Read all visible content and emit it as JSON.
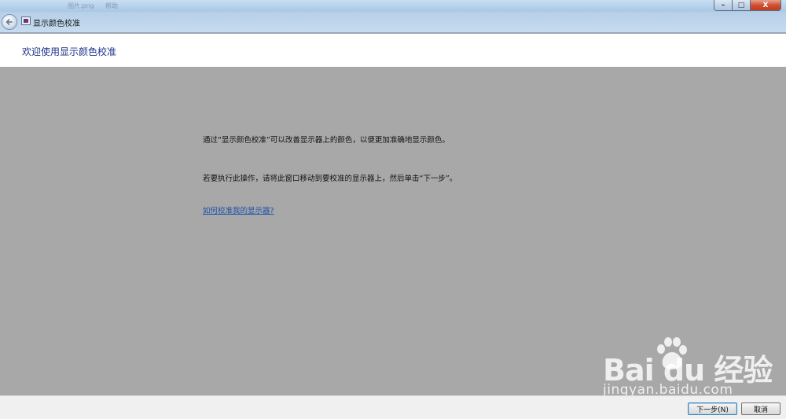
{
  "titlebar": {
    "background_texts": [
      "图片.png",
      "帮助"
    ],
    "caption_buttons": {
      "minimize": "–",
      "maximize": "□",
      "close": "X"
    }
  },
  "nav": {
    "title": "显示颜色校准",
    "back_icon": "back-arrow-icon",
    "app_icon": "display-color-calibration-icon"
  },
  "header": {
    "title": "欢迎使用显示颜色校准"
  },
  "content": {
    "paragraph1": "通过“显示颜色校准”可以改善显示器上的颜色，以便更加准确地显示颜色。",
    "paragraph2": "若要执行此操作，请将此窗口移动到要校准的显示器上，然后单击“下一步”。",
    "help_link": "如何校准我的显示器?"
  },
  "watermark": {
    "brand": "Bai du 经验",
    "url": "jingyan.baidu.com",
    "icon": "baidu-paw-icon"
  },
  "footer": {
    "next_button": "下一步(N)",
    "cancel_button": "取消"
  },
  "colors": {
    "content_bg": "#a8a8a8",
    "header_title": "#1e3287",
    "link": "#1b4fa8",
    "footer_bg": "#f0f0f0"
  }
}
